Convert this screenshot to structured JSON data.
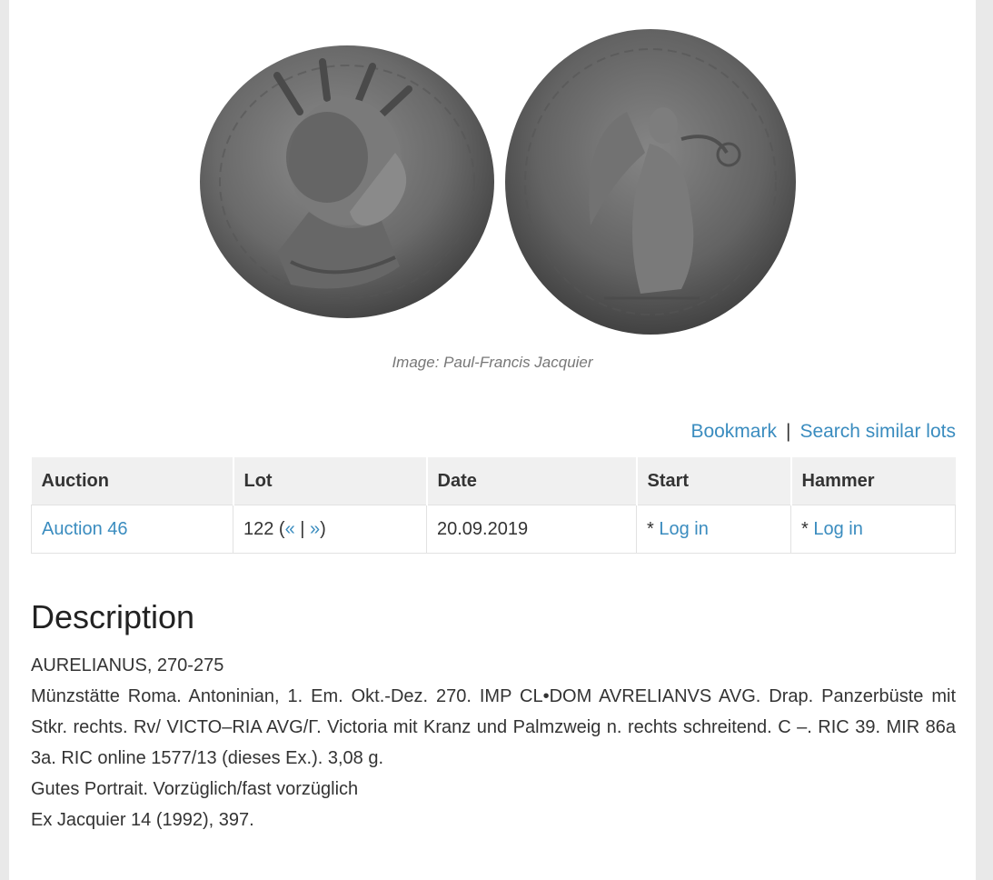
{
  "image": {
    "credit": "Image: Paul-Francis Jacquier",
    "obverse_icon": "coin-obverse-portrait",
    "reverse_icon": "coin-reverse-victoria"
  },
  "actions": {
    "bookmark": "Bookmark",
    "separator": "|",
    "search_similar": "Search similar lots"
  },
  "lot_table": {
    "headers": [
      "Auction",
      "Lot",
      "Date",
      "Start",
      "Hammer"
    ],
    "auction": "Auction 46",
    "lot_number": "122 (",
    "prev": "«",
    "lot_sep": " | ",
    "next": "»",
    "lot_close": ")",
    "date": "20.09.2019",
    "start_prefix": "* ",
    "start_login": "Log in",
    "hammer_prefix": "* ",
    "hammer_login": "Log in"
  },
  "description": {
    "title": "Description",
    "lines": [
      "AURELIANUS, 270-275",
      "Münzstätte Roma. Antoninian, 1. Em. Okt.-Dez. 270. IMP CL•DOM AVRELIANVS AVG. Drap. Panzerbüste mit Stkr. rechts. Rv/ VICTO–RIA AVG/Γ. Victoria mit Kranz und Palmzweig n. rechts schreitend. C –. RIC 39. MIR 86a 3a. RIC online 1577/13 (dieses Ex.). 3,08 g.",
      "Gutes Portrait. Vorzüglich/fast vorzüglich",
      "Ex Jacquier 14 (1992), 397."
    ]
  },
  "colors": {
    "link": "#3a8cbf",
    "header_bg": "#f0f0f0",
    "coin": "#6a6a6a"
  }
}
